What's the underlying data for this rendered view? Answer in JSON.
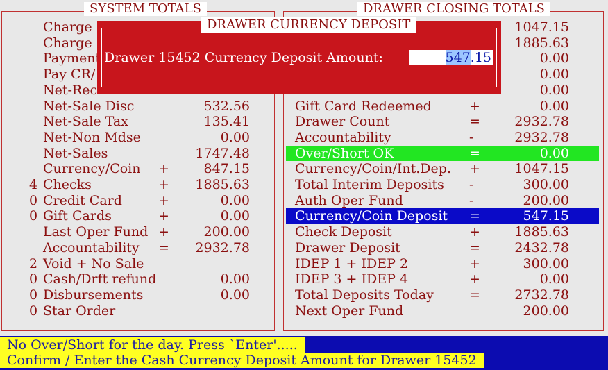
{
  "system_totals": {
    "title": "SYSTEM TOTALS",
    "rows": [
      {
        "count": "",
        "label": "Charge",
        "op": "",
        "value": ""
      },
      {
        "count": "",
        "label": "Charge",
        "op": "",
        "value": ""
      },
      {
        "count": "",
        "label": "Payment",
        "op": "",
        "value": ""
      },
      {
        "count": "",
        "label": "Pay CR/",
        "op": "",
        "value": ""
      },
      {
        "count": "",
        "label": "Net-Rec",
        "op": "",
        "value": ""
      },
      {
        "count": "",
        "label": "Net-Sale Disc",
        "op": "",
        "value": "532.56"
      },
      {
        "count": "",
        "label": "Net-Sale Tax",
        "op": "",
        "value": "135.41"
      },
      {
        "count": "",
        "label": "Net-Non Mdse",
        "op": "",
        "value": "0.00"
      },
      {
        "count": "",
        "label": "Net-Sales",
        "op": "",
        "value": "1747.48"
      },
      {
        "count": "",
        "label": "Currency/Coin",
        "op": "+",
        "value": "847.15"
      },
      {
        "count": "4",
        "label": "Checks",
        "op": "+",
        "value": "1885.63"
      },
      {
        "count": "0",
        "label": "Credit Card",
        "op": "+",
        "value": "0.00"
      },
      {
        "count": "0",
        "label": "Gift Cards",
        "op": "+",
        "value": "0.00"
      },
      {
        "count": "",
        "label": "Last Oper Fund",
        "op": "+",
        "value": "200.00"
      },
      {
        "count": "",
        "label": "Accountability",
        "op": "=",
        "value": "2932.78"
      },
      {
        "count": "2",
        "label": "Void + No Sale",
        "op": "",
        "value": ""
      },
      {
        "count": "0",
        "label": "Cash/Drft refund",
        "op": "",
        "value": "0.00"
      },
      {
        "count": "0",
        "label": "Disbursements",
        "op": "",
        "value": "0.00"
      },
      {
        "count": "0",
        "label": "Star Order",
        "op": "",
        "value": ""
      }
    ]
  },
  "drawer_closing": {
    "title": "DRAWER CLOSING TOTALS",
    "rows": [
      {
        "label": "",
        "op": "",
        "value": "1047.15"
      },
      {
        "label": "",
        "op": "",
        "value": "1885.63"
      },
      {
        "label": "",
        "op": "",
        "value": "0.00"
      },
      {
        "label": "",
        "op": "",
        "value": "0.00"
      },
      {
        "label": "",
        "op": "",
        "value": "0.00"
      },
      {
        "label": "Gift Card Redeemed",
        "op": "+",
        "value": "0.00"
      },
      {
        "label": "Drawer Count",
        "op": "=",
        "value": "2932.78"
      },
      {
        "label": "Accountability",
        "op": "-",
        "value": "2932.78"
      },
      {
        "label": "Over/Short OK",
        "op": "=",
        "value": "0.00"
      },
      {
        "label": "Currency/Coin/Int.Dep.",
        "op": "+",
        "value": "1047.15"
      },
      {
        "label": "Total Interim Deposits",
        "op": "-",
        "value": "300.00"
      },
      {
        "label": "Auth Oper Fund",
        "op": "-",
        "value": "200.00"
      },
      {
        "label": "Currency/Coin Deposit",
        "op": "=",
        "value": "547.15"
      },
      {
        "label": "Check Deposit",
        "op": "+",
        "value": "1885.63"
      },
      {
        "label": "Drawer Deposit",
        "op": "=",
        "value": "2432.78"
      },
      {
        "label": "IDEP 1 + IDEP 2",
        "op": "+",
        "value": "300.00"
      },
      {
        "label": "IDEP 3 + IDEP 4",
        "op": "+",
        "value": "0.00"
      },
      {
        "label": "Total Deposits Today",
        "op": "=",
        "value": "2732.78"
      },
      {
        "label": "Next Oper Fund",
        "op": "",
        "value": "200.00"
      }
    ]
  },
  "dialog": {
    "title": "DRAWER CURRENCY DEPOSIT",
    "prompt": "Drawer 15452 Currency Deposit Amount:",
    "input_selected": "547",
    "input_rest": ".15"
  },
  "status": {
    "line1": "No Over/Short for the day. Press `Enter'.....",
    "line2": "Confirm / Enter the Cash Currency Deposit Amount for Drawer 15452"
  },
  "colors": {
    "text": "#8b1010",
    "dialog_bg": "#c8151c",
    "highlight_green": "#22e622",
    "highlight_blue": "#0a0ac8",
    "status_yellow": "#ffff22",
    "status_bar": "#0c0cb0"
  }
}
